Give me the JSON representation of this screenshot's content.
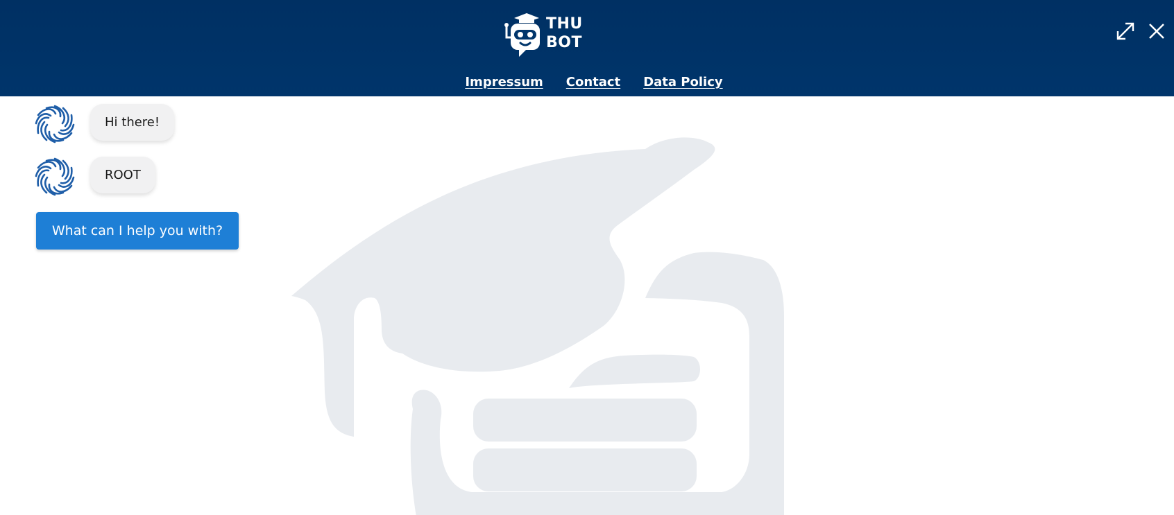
{
  "header": {
    "logo_line1": "THU",
    "logo_line2": "BOT",
    "expand_icon": "expand-icon",
    "close_icon": "close-icon"
  },
  "nav": {
    "links": [
      {
        "label": "Impressum"
      },
      {
        "label": "Contact"
      },
      {
        "label": "Data Policy"
      }
    ]
  },
  "chat": {
    "messages": [
      {
        "text": "Hi there!",
        "avatar": "bot-avatar"
      },
      {
        "text": "ROOT",
        "avatar": "bot-avatar"
      }
    ],
    "quick_reply": "What can I help you with?"
  },
  "colors": {
    "header_bg": "#00356b",
    "button_bg": "#1e7fd6",
    "bubble_bg": "#f1f1f2",
    "watermark": "#e8ebef",
    "avatar_blue": "#1f5ea8"
  }
}
